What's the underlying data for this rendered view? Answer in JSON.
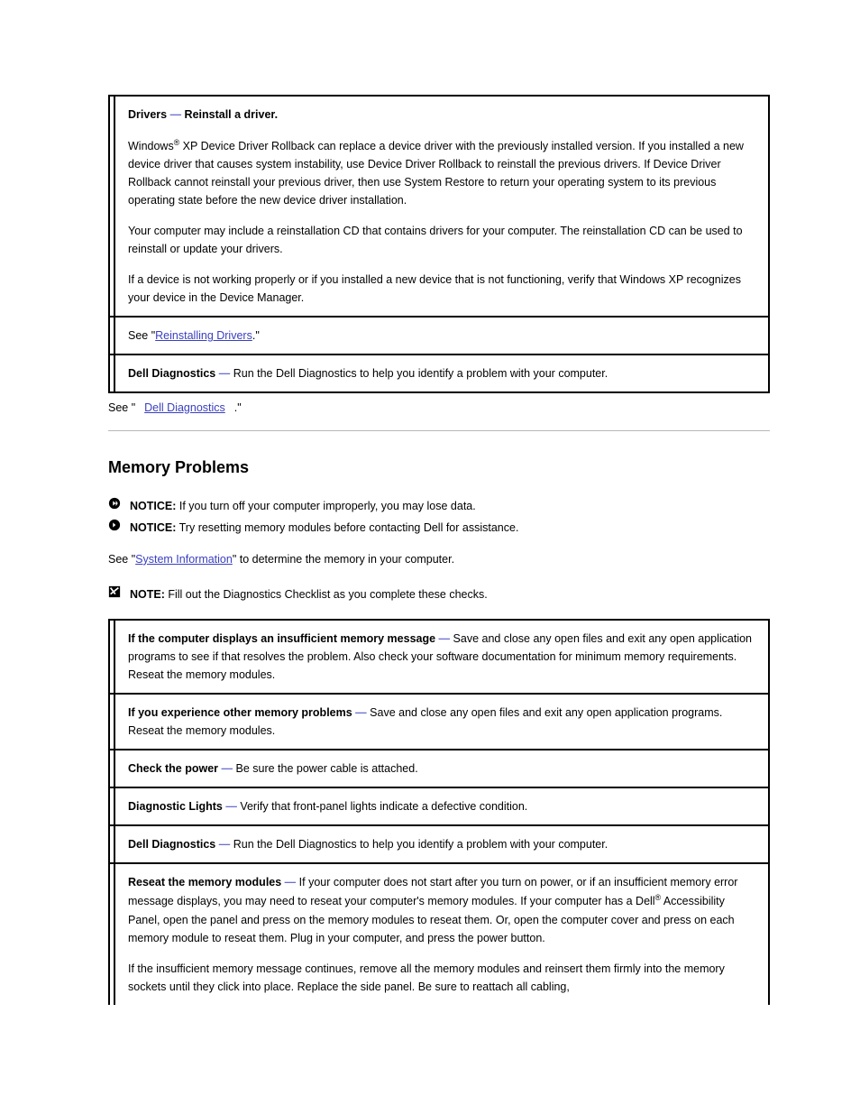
{
  "table1": {
    "row_drivers": {
      "heading_pre": "Drivers ",
      "heading_dash": "— ",
      "heading_post": "Reinstall a driver.",
      "p1_pre": "Windows",
      "p1_sup": "®",
      "p1_post": " XP Device Driver Rollback can replace a device driver with the previously installed version. If you installed a new device driver that causes system instability, use Device Driver Rollback to reinstall the previous drivers. If Device Driver Rollback cannot reinstall your previous driver, then use System Restore to return your operating system to its previous operating state before the new device driver installation.",
      "p2": "Your computer may include a reinstallation CD that contains drivers for your computer. The reinstallation CD can be used to reinstall or update your drivers.",
      "p3": "If a device is not working properly or if you installed a new device that is not functioning, verify that Windows XP recognizes your device in the Device Manager."
    },
    "row_see": {
      "pre": "See \"",
      "link": "Reinstalling Drivers",
      "post": ".\""
    },
    "row_dell": {
      "pre": "Dell Diagnostics ",
      "dash": "— ",
      "post": "Run the Dell Diagnostics to help you identify a problem with your computer."
    }
  },
  "link_dell_diag": "Dell Diagnostics",
  "section_title": "Memory Problems",
  "notice1": {
    "label": "NOTICE:",
    "text": " If you turn off your computer improperly, you may lose data."
  },
  "notice2": {
    "label": "NOTICE:",
    "text": " Try resetting memory modules before contacting Dell for assistance."
  },
  "para_sysinfo": {
    "pre": "See \"",
    "link": "System Information",
    "post": "\" to determine the memory in your computer."
  },
  "note": {
    "label": "NOTE:",
    "text": " Fill out the Diagnostics Checklist as you complete these checks."
  },
  "table2": {
    "row_insufficient": {
      "pre": "If the computer displays an insufficient memory message ",
      "dash": "— ",
      "post": "Save and close any open files and exit any open application programs to see if that resolves the problem. Also check your software documentation for minimum memory requirements. Reseat the memory modules."
    },
    "row_other": {
      "pre": "If you experience other memory problems ",
      "dash": "— ",
      "post": "Save and close any open files and exit any open application programs. Reseat the memory modules."
    },
    "row_power": {
      "pre": "Check the power ",
      "dash": "— ",
      "post": "Be sure the power cable is attached."
    },
    "row_lights": {
      "pre": "Diagnostic Lights ",
      "dash": "— ",
      "post": "Verify that front-panel lights indicate a defective condition."
    },
    "row_dell_diag": {
      "pre": "Dell Diagnostics ",
      "dash": "— ",
      "post": "Run the Dell Diagnostics to help you identify a problem with your computer."
    },
    "row_reseat": {
      "pre": "Reseat the memory modules ",
      "dash": "— ",
      "post": "If your computer does not start after you turn on power, or if an insufficient memory error message displays, you may need to reseat your computer's memory modules. If your computer has a Dell",
      "sup": "®",
      "tail1": " Accessibility Panel, open the panel and press on the memory modules to reseat them. Or, open the computer cover and press on each memory module to reseat them. Plug in your computer, and press the power button.",
      "tail2": "If the insufficient memory message continues, remove all the memory modules and reinsert them firmly into the memory sockets until they click into place. Replace the side panel. Be sure to reattach all cabling,"
    }
  }
}
